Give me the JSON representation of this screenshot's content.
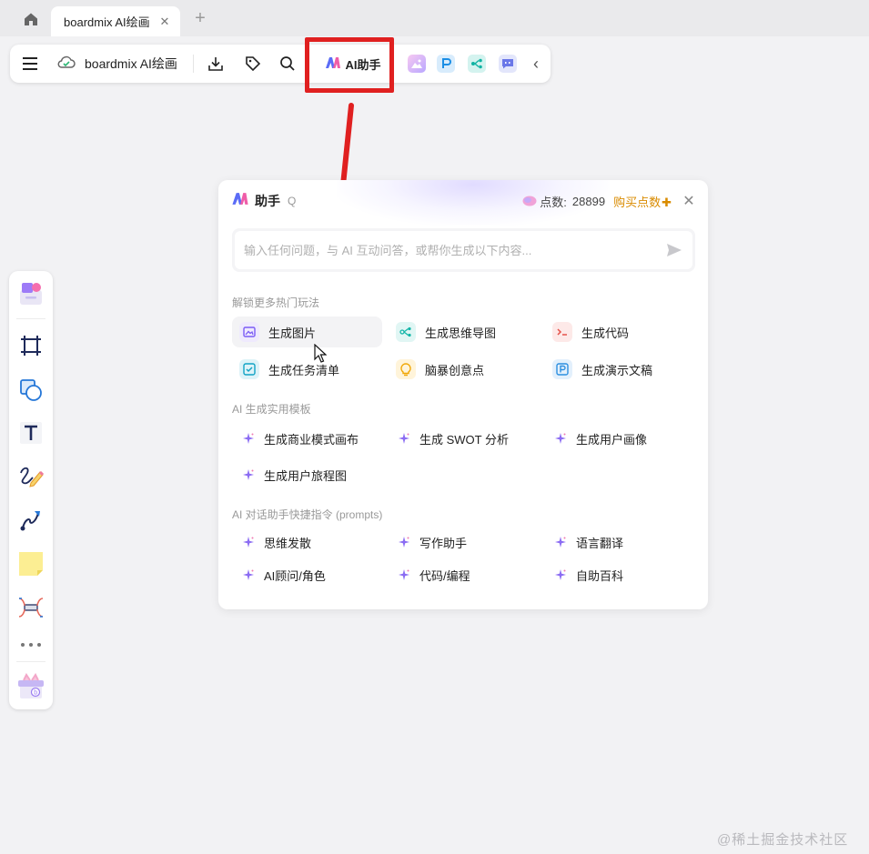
{
  "browser": {
    "tab_title": "boardmix AI绘画",
    "close_glyph": "✕",
    "new_tab_glyph": "+"
  },
  "toolbar": {
    "doc_title": "boardmix AI绘画",
    "ai_label": "AI助手",
    "collapse_glyph": "‹"
  },
  "panel": {
    "title": "助手",
    "shortcut": "Q",
    "points_label": "点数:",
    "points_value": "28899",
    "buy_label": "购买点数",
    "close_glyph": "✕",
    "input_placeholder": "输入任何问题，与 AI 互动问答，或帮你生成以下内容...",
    "section_hot": "解锁更多热门玩法",
    "hot_items": [
      {
        "label": "生成图片",
        "icon": "image-icon",
        "color": "#7b5cf5",
        "bg": "#efeafd"
      },
      {
        "label": "生成思维导图",
        "icon": "mindmap-icon",
        "color": "#12b5a8",
        "bg": "#e1f6f4"
      },
      {
        "label": "生成代码",
        "icon": "code-icon",
        "color": "#e5534b",
        "bg": "#fde9e8"
      },
      {
        "label": "生成任务清单",
        "icon": "checklist-icon",
        "color": "#11a3c5",
        "bg": "#def3f8"
      },
      {
        "label": "脑暴创意点",
        "icon": "bulb-icon",
        "color": "#f0a500",
        "bg": "#fff4da"
      },
      {
        "label": "生成演示文稿",
        "icon": "presentation-icon",
        "color": "#2d8fe0",
        "bg": "#e3f0fc"
      }
    ],
    "section_templates": "AI 生成实用模板",
    "templates": [
      "生成商业模式画布",
      "生成 SWOT 分析",
      "生成用户画像",
      "生成用户旅程图"
    ],
    "section_prompts": "AI 对话助手快捷指令 (prompts)",
    "prompts": [
      "思维发散",
      "写作助手",
      "语言翻译",
      "AI顾问/角色",
      "代码/编程",
      "自助百科"
    ]
  },
  "watermark": "@稀土掘金技术社区",
  "colors": {
    "accent_red": "#e02020",
    "buy_orange": "#d98b00"
  }
}
